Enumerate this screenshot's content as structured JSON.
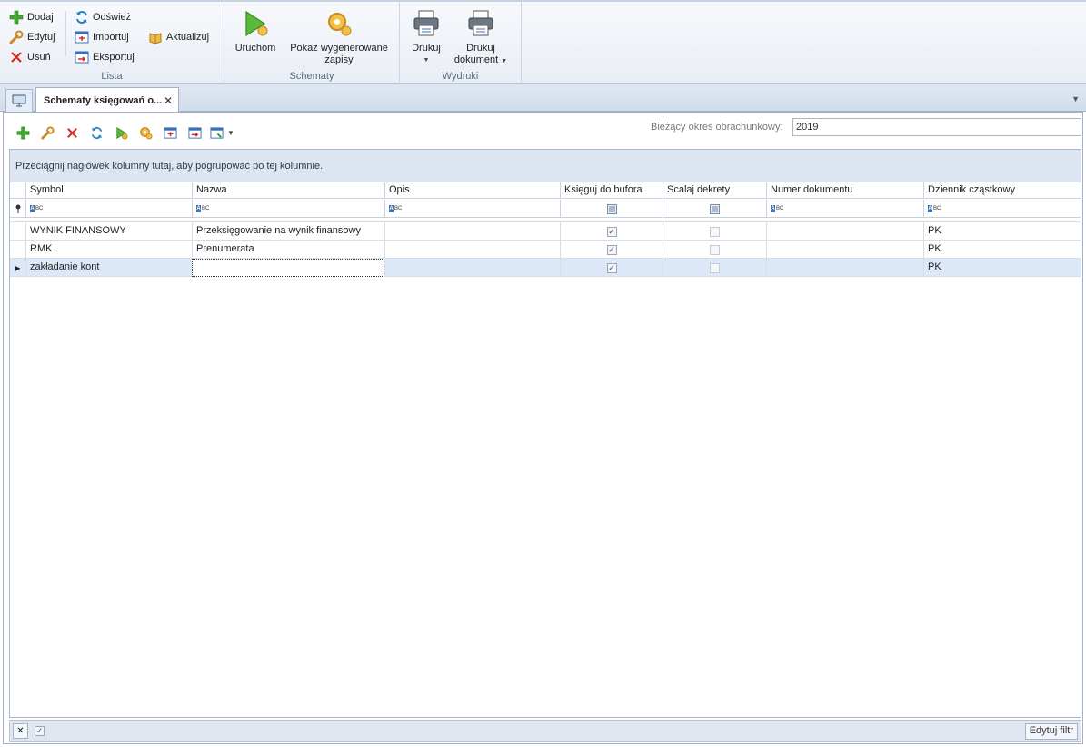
{
  "ribbon": {
    "lista": {
      "title": "Lista",
      "dodaj": "Dodaj",
      "edytuj": "Edytuj",
      "usun": "Usuń",
      "odswiez": "Odśwież",
      "importuj": "Importuj",
      "eksportuj": "Eksportuj",
      "aktualizuj": "Aktualizuj"
    },
    "schematy": {
      "title": "Schematy",
      "uruchom": "Uruchom",
      "pokaz_line1": "Pokaż wygenerowane",
      "pokaz_line2": "zapisy"
    },
    "wydruki": {
      "title": "Wydruki",
      "drukuj": "Drukuj",
      "drukuj_dok_line1": "Drukuj",
      "drukuj_dok_line2": "dokument"
    }
  },
  "tabs": {
    "active_label": "Schematy księgowań o...",
    "close_glyph": "✕"
  },
  "period": {
    "label": "Bieżący okres obrachunkowy:",
    "value": "2019"
  },
  "grid": {
    "group_hint": "Przeciągnij nagłówek kolumny tutaj, aby pogrupować po tej kolumnie.",
    "columns": [
      "Symbol",
      "Nazwa",
      "Opis",
      "Księguj do bufora",
      "Scalaj dekrety",
      "Numer dokumentu",
      "Dziennik cząstkowy"
    ],
    "rows": [
      {
        "symbol": "WYNIK FINANSOWY",
        "nazwa": "Przeksięgowanie na wynik finansowy",
        "opis": "",
        "bufor": true,
        "scalaj": false,
        "numer": "",
        "dziennik": "PK"
      },
      {
        "symbol": "RMK",
        "nazwa": "Prenumerata",
        "opis": "",
        "bufor": true,
        "scalaj": false,
        "numer": "",
        "dziennik": "PK"
      },
      {
        "symbol": "zakładanie kont",
        "nazwa": "",
        "opis": "",
        "bufor": true,
        "scalaj": false,
        "numer": "",
        "dziennik": "PK"
      }
    ]
  },
  "footer": {
    "edit_filter": "Edytuj filtr"
  },
  "colors": {
    "accent": "#3d6fb5",
    "selected_row": "#dce8f7",
    "group_panel": "#dde6f0"
  },
  "icons": [
    "plus-icon",
    "wrench-icon",
    "delete-icon",
    "refresh-icon",
    "import-icon",
    "export-icon",
    "update-icon",
    "run-icon",
    "gear-doc-icon",
    "printer-icon"
  ]
}
